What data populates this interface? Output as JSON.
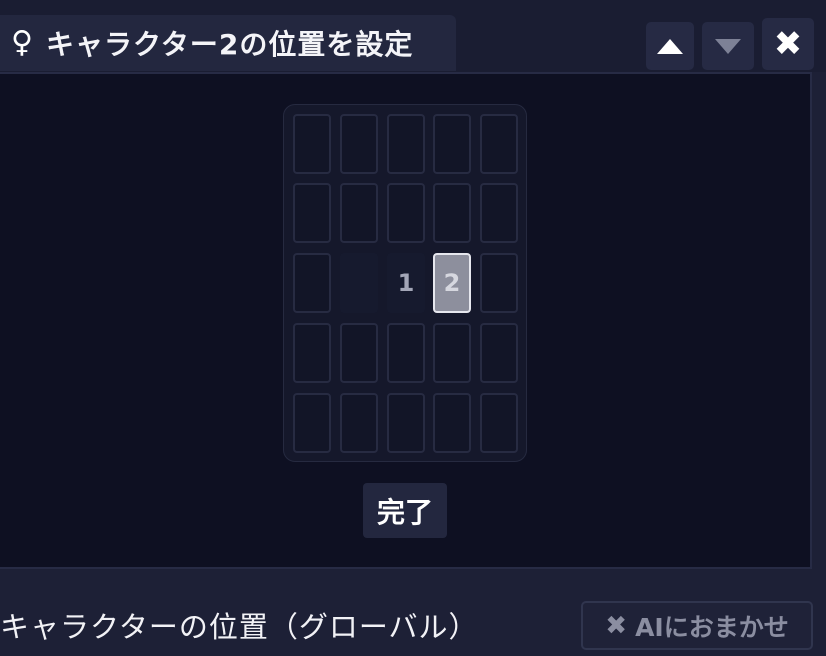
{
  "dialog": {
    "title_icon": "♀",
    "title": "キャラクター2の位置を設定",
    "close_glyph": "✖"
  },
  "grid": {
    "rows": 5,
    "cols": 5,
    "cells": [
      {
        "row": 2,
        "col": 2,
        "label": "1",
        "state": "placed"
      },
      {
        "row": 2,
        "col": 3,
        "label": "2",
        "state": "selected"
      }
    ],
    "empty_cells_hidden": [
      {
        "row": 2,
        "col": 1
      }
    ]
  },
  "done_button": {
    "label": "完了"
  },
  "footer": {
    "label": "キャラクターの位置（グローバル）",
    "ai_button": {
      "icon": "✖",
      "label": "AIにおまかせ"
    }
  },
  "colors": {
    "background": "#1d2036",
    "panel": "#0e1022",
    "selected_cell": "#8d8f9d",
    "button": "#23273f"
  }
}
